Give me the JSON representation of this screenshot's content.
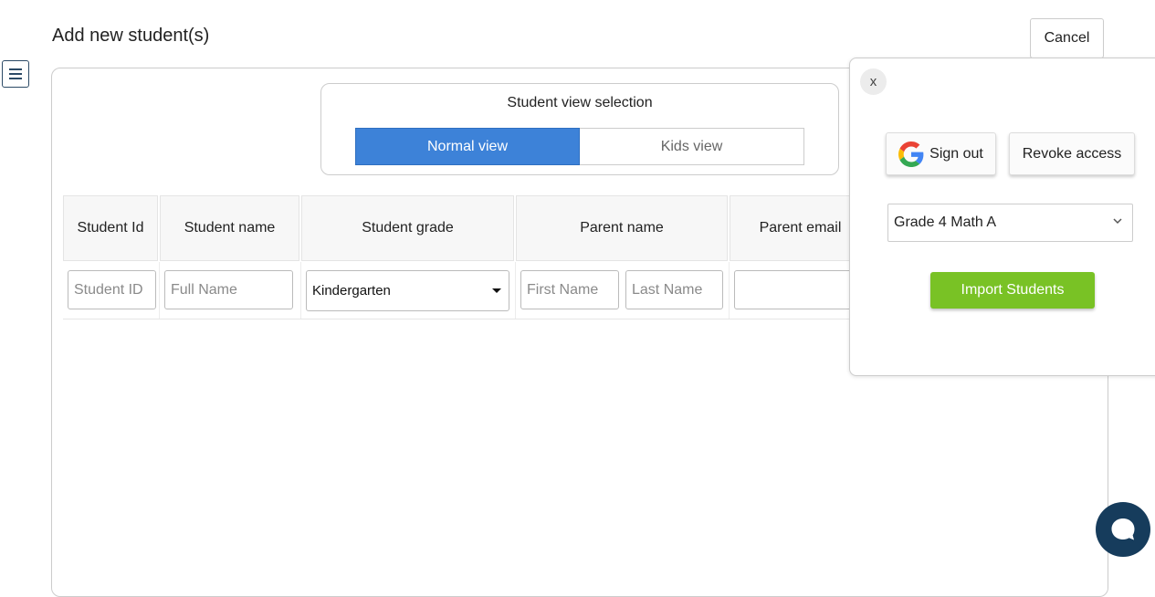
{
  "header": {
    "title": "Add new student(s)",
    "cancel_label": "Cancel"
  },
  "view_selection": {
    "title": "Student view selection",
    "options": [
      "Normal view",
      "Kids view"
    ],
    "selected": "Normal view"
  },
  "table": {
    "columns": [
      "Student Id",
      "Student name",
      "Student grade",
      "Parent name",
      "Parent email"
    ],
    "row": {
      "student_id_placeholder": "Student ID",
      "full_name_placeholder": "Full Name",
      "grade_value": "Kindergarten",
      "first_name_placeholder": "First Name",
      "last_name_placeholder": "Last Name",
      "parent_email_value": ""
    }
  },
  "import_popup": {
    "close_label": "x",
    "sign_out_label": "Sign out",
    "revoke_label": "Revoke access",
    "class_value": "Grade 4 Math A",
    "import_label": "Import Students"
  },
  "colors": {
    "accent_blue": "#3d82d8",
    "import_green": "#79c225",
    "chat_navy": "#163c5c"
  },
  "icons": [
    "menu-icon",
    "google-icon",
    "chevron-down-icon",
    "caret-down-icon",
    "chat-icon"
  ]
}
